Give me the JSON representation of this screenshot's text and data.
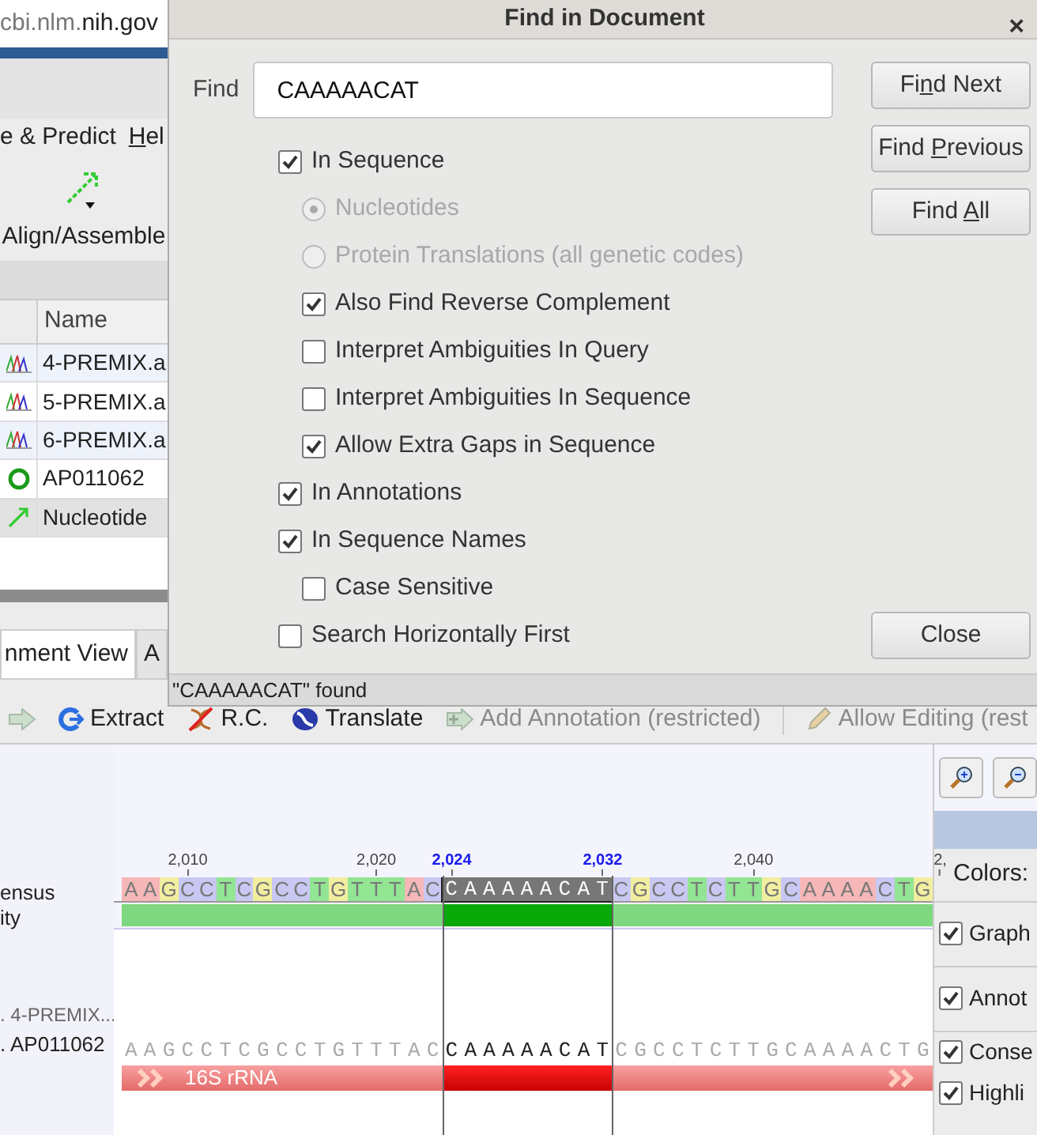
{
  "browser": {
    "url_prefix": "cbi.nlm.",
    "url_domain": "nih.gov"
  },
  "menu": [
    {
      "after": "e & Predict"
    },
    {
      "key": "H",
      "after": "el"
    }
  ],
  "toolbar": {
    "label": "Align/Assemble"
  },
  "documents": {
    "columns": [
      "Name"
    ],
    "rows": [
      {
        "kind": "chromatogram",
        "name": "4-PREMIX.a",
        "selected": false
      },
      {
        "kind": "chromatogram",
        "name": "5-PREMIX.a",
        "selected": false
      },
      {
        "kind": "chromatogram",
        "name": "6-PREMIX.a",
        "selected": false
      },
      {
        "kind": "sequence",
        "name": "AP011062",
        "selected": false
      },
      {
        "kind": "alignment",
        "name": "Nucleotide",
        "selected": true
      }
    ]
  },
  "viewer_tabs": [
    {
      "label": "nment View",
      "selected": true
    },
    {
      "label": "A",
      "selected": false
    }
  ],
  "sequence_toolbar": [
    {
      "kind": "back",
      "disabled": true
    },
    {
      "kind": "extract",
      "label": "Extract",
      "disabled": false
    },
    {
      "kind": "rc",
      "label": "R.C.",
      "disabled": false
    },
    {
      "kind": "translate",
      "label": "Translate",
      "disabled": false
    },
    {
      "kind": "annotate",
      "label": "Add Annotation (restricted)",
      "disabled": true
    },
    {
      "kind": "edit",
      "label": "Allow Editing (rest",
      "disabled": true
    }
  ],
  "sequence_view": {
    "ticks": [
      {
        "label": "2,010",
        "selected": false
      },
      {
        "label": "2,020",
        "selected": false
      },
      {
        "label": "2,024",
        "selected": true
      },
      {
        "label": "2,032",
        "selected": true
      },
      {
        "label": "2,040",
        "selected": false
      },
      {
        "label": "2,",
        "selected": false
      }
    ],
    "row_labels": [
      {
        "label": "ensus",
        "kind": "consensus"
      },
      {
        "label": "ity",
        "kind": "identity"
      },
      {
        "label": ". 4-PREMIX...",
        "kind": "muted"
      },
      {
        "label": ". AP011062",
        "kind": "sequence"
      }
    ],
    "consensus": {
      "before": [
        {
          "base": "A",
          "color": "#f5b7b7"
        },
        {
          "base": "A",
          "color": "#f5b7b7"
        },
        {
          "base": "G",
          "color": "#f2eea0"
        },
        {
          "base": "C",
          "color": "#c8c8f2"
        },
        {
          "base": "C",
          "color": "#c8c8f2"
        },
        {
          "base": "T",
          "color": "#92e592"
        },
        {
          "base": "C",
          "color": "#c8c8f2"
        },
        {
          "base": "G",
          "color": "#f2eea0"
        },
        {
          "base": "C",
          "color": "#c8c8f2"
        },
        {
          "base": "C",
          "color": "#c8c8f2"
        },
        {
          "base": "T",
          "color": "#92e592"
        },
        {
          "base": "G",
          "color": "#f2eea0"
        },
        {
          "base": "T",
          "color": "#92e592"
        },
        {
          "base": "T",
          "color": "#92e592"
        },
        {
          "base": "T",
          "color": "#92e592"
        },
        {
          "base": "A",
          "color": "#f5b7b7"
        },
        {
          "base": "C",
          "color": "#c8c8f2"
        }
      ],
      "match": "CAAAAACAT",
      "after": [
        {
          "base": "C",
          "color": "#c8c8f2"
        },
        {
          "base": "G",
          "color": "#f2eea0"
        },
        {
          "base": "C",
          "color": "#c8c8f2"
        },
        {
          "base": "C",
          "color": "#c8c8f2"
        },
        {
          "base": "T",
          "color": "#92e592"
        },
        {
          "base": "C",
          "color": "#c8c8f2"
        },
        {
          "base": "T",
          "color": "#92e592"
        },
        {
          "base": "T",
          "color": "#92e592"
        },
        {
          "base": "G",
          "color": "#f2eea0"
        },
        {
          "base": "C",
          "color": "#c8c8f2"
        },
        {
          "base": "A",
          "color": "#f5b7b7"
        },
        {
          "base": "A",
          "color": "#f5b7b7"
        },
        {
          "base": "A",
          "color": "#f5b7b7"
        },
        {
          "base": "A",
          "color": "#f5b7b7"
        },
        {
          "base": "C",
          "color": "#c8c8f2"
        },
        {
          "base": "T",
          "color": "#92e592"
        },
        {
          "base": "G",
          "color": "#f2eea0"
        }
      ]
    },
    "sequence": {
      "before": "AAGCCTCGCCTGTTTAC",
      "match": "CAAAAACAT",
      "after": "CGCCTCTTGCAAAACTG"
    },
    "annotation": {
      "label": "16S rRNA"
    },
    "colors_label": "Colors:",
    "panel_options": [
      {
        "label": "Graph",
        "checked": true
      },
      {
        "label": "Annot",
        "checked": true
      },
      {
        "label": "Conse",
        "checked": true
      },
      {
        "label": "Highli",
        "checked": true
      }
    ]
  },
  "dialog": {
    "title": "Find in Document",
    "close_icon": "×",
    "find": {
      "label": "Find",
      "value": "CAAAAACAT"
    },
    "buttons": [
      {
        "before": "Fi",
        "key": "n",
        "after": "d Next"
      },
      {
        "before": "Find ",
        "key": "P",
        "after": "revious"
      },
      {
        "before": "Find ",
        "key": "A",
        "after": "ll"
      }
    ],
    "options": [
      {
        "kind": "checkbox",
        "label": "In Sequence",
        "checked": true,
        "disabled": false,
        "children": [
          {
            "kind": "radio",
            "label": "Nucleotides",
            "selected": true,
            "disabled": true
          },
          {
            "kind": "radio",
            "label": "Protein Translations (all genetic codes)",
            "selected": false,
            "disabled": true
          },
          {
            "kind": "checkbox",
            "label": "Also Find Reverse Complement",
            "checked": true,
            "disabled": false
          },
          {
            "kind": "checkbox",
            "label": "Interpret Ambiguities In Query",
            "checked": false,
            "disabled": false
          },
          {
            "kind": "checkbox",
            "label": "Interpret Ambiguities In Sequence",
            "checked": false,
            "disabled": false
          },
          {
            "kind": "checkbox",
            "label": "Allow Extra Gaps in Sequence",
            "checked": true,
            "disabled": false
          }
        ]
      },
      {
        "kind": "checkbox",
        "label": "In Annotations",
        "checked": true,
        "disabled": false
      },
      {
        "kind": "checkbox",
        "label": "In Sequence Names",
        "checked": true,
        "disabled": false,
        "children": [
          {
            "kind": "checkbox",
            "label": "Case Sensitive",
            "checked": false,
            "disabled": false
          }
        ]
      },
      {
        "kind": "checkbox",
        "label": "Search Horizontally First",
        "checked": false,
        "disabled": false
      }
    ],
    "close_button": "Close",
    "status": "\"CAAAAACAT\" found"
  }
}
